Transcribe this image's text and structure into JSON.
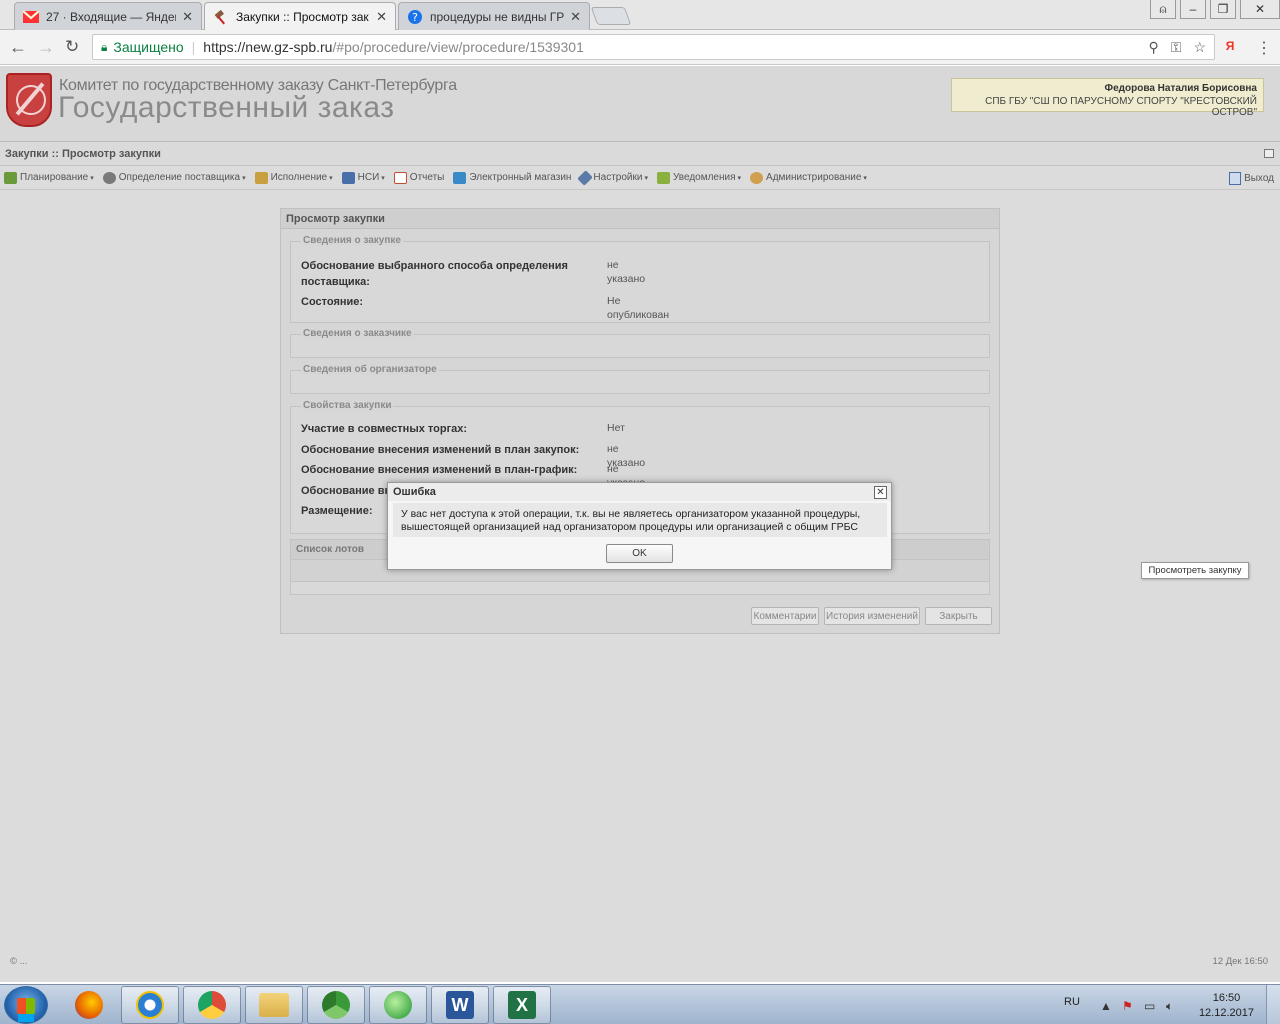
{
  "browser": {
    "tabs": [
      {
        "title": "27 · Входящие — Яндекс",
        "icon": "yandex-mail-icon"
      },
      {
        "title": "Закупки :: Просмотр зак",
        "icon": "gavel-icon"
      },
      {
        "title": "процедуры не видны ГР",
        "icon": "help-icon"
      }
    ],
    "address": {
      "secure_label": "Защищено",
      "url_host": "https://new.gz-spb.ru",
      "url_path": "/#po/procedure/view/procedure/1539301"
    },
    "yandex_badge": "Я"
  },
  "header": {
    "org_line": "Комитет по государственному заказу Санкт-Петербурга",
    "app_title": "Государственный заказ",
    "user_name": "Федорова Наталия Борисовна",
    "user_org": "СПБ ГБУ \"СШ ПО ПАРУСНОМУ СПОРТУ \"КРЕСТОВСКИЙ ОСТРОВ\""
  },
  "breadcrumb": "Закупки :: Просмотр закупки",
  "toolbar": [
    {
      "label": "Планирование",
      "icon": "planning-icon",
      "caret": "▾",
      "color": "#6a9a3a"
    },
    {
      "label": "Определение поставщика",
      "icon": "supplier-icon",
      "caret": "▾",
      "color": "#7a7a7a"
    },
    {
      "label": "Исполнение",
      "icon": "execution-icon",
      "caret": "▾",
      "color": "#c8a040"
    },
    {
      "label": "НСИ",
      "icon": "reference-icon",
      "caret": "▾",
      "color": "#4a6ea8"
    },
    {
      "label": "Отчеты",
      "icon": "report-icon",
      "caret": "",
      "color": "#c05030"
    },
    {
      "label": "Электронный магазин",
      "icon": "shop-icon",
      "caret": "",
      "color": "#3a8ac8"
    },
    {
      "label": "Настройки",
      "icon": "settings-icon",
      "caret": "▾",
      "color": "#5a7aa8"
    },
    {
      "label": "Уведомления",
      "icon": "notifications-icon",
      "caret": "▾",
      "color": "#8ab040"
    },
    {
      "label": "Администрирование",
      "icon": "admin-icon",
      "caret": "▾",
      "color": "#d0a050"
    }
  ],
  "exit_label": "Выход",
  "panel": {
    "title": "Просмотр закупки",
    "sections": {
      "purchase": {
        "legend": "Сведения о закупке",
        "rows": [
          {
            "label": "Обоснование выбранного способа определения поставщика:",
            "value": "не указано"
          },
          {
            "label": "Состояние:",
            "value": "Не опубликован"
          }
        ]
      },
      "customer": {
        "legend": "Сведения о заказчике"
      },
      "organizer": {
        "legend": "Сведения об организаторе"
      },
      "properties": {
        "legend": "Свойства закупки",
        "rows": [
          {
            "label": "Участие в совместных торгах:",
            "value": "Нет"
          },
          {
            "label": "Обоснование внесения изменений в план закупок:",
            "value": "не указано"
          },
          {
            "label": "Обоснование внесения изменений в план-график:",
            "value": "не указано"
          },
          {
            "label": "Обоснование вн",
            "value": ""
          },
          {
            "label": "Размещение:",
            "value": ""
          }
        ]
      }
    },
    "lots_title": "Список лотов",
    "buttons": {
      "comments": "Комментарии",
      "history": "История изменений",
      "close": "Закрыть"
    }
  },
  "dialog": {
    "title": "Ошибка",
    "message_line1": "У вас нет доступа к этой операции, т.к. вы не являетесь организатором указанной процедуры,",
    "message_line2": "вышестоящей организацией над организатором процедуры или организацией с общим ГРБС",
    "ok_label": "OK"
  },
  "tooltip": "Просмотреть закупку",
  "status": {
    "left": "© ...",
    "right": "12 Дек 16:50"
  },
  "taskbar": {
    "apps": [
      {
        "name": "firefox",
        "color": "#e66000"
      },
      {
        "name": "internet-explorer",
        "color": "#2a7fd4"
      },
      {
        "name": "chrome",
        "color": "#dd4b39"
      },
      {
        "name": "file-explorer",
        "color": "#d9b04a"
      },
      {
        "name": "recycle",
        "color": "#3a9a3a"
      },
      {
        "name": "messenger",
        "color": "#4caf50"
      },
      {
        "name": "word",
        "color": "#2b579a"
      },
      {
        "name": "excel",
        "color": "#217346"
      }
    ],
    "lang": "RU",
    "time": "16:50",
    "date": "12.12.2017"
  }
}
